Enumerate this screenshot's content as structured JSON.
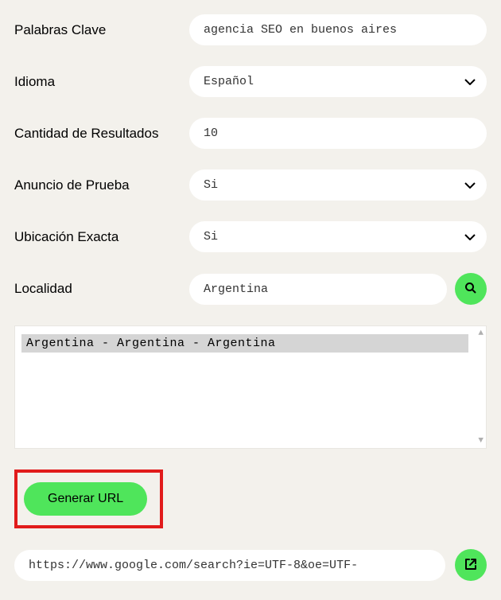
{
  "fields": {
    "keywords": {
      "label": "Palabras Clave",
      "value": "agencia SEO en buenos aires"
    },
    "language": {
      "label": "Idioma",
      "value": "Español"
    },
    "results_count": {
      "label": "Cantidad de Resultados",
      "value": "10"
    },
    "test_ad": {
      "label": "Anuncio de Prueba",
      "value": "Si"
    },
    "exact_location": {
      "label": "Ubicación Exacta",
      "value": "Si"
    },
    "locality": {
      "label": "Localidad",
      "value": "Argentina"
    }
  },
  "results_list": {
    "item": "Argentina - Argentina - Argentina"
  },
  "buttons": {
    "generate": "Generar URL"
  },
  "output": {
    "url": "https://www.google.com/search?ie=UTF-8&oe=UTF-"
  }
}
